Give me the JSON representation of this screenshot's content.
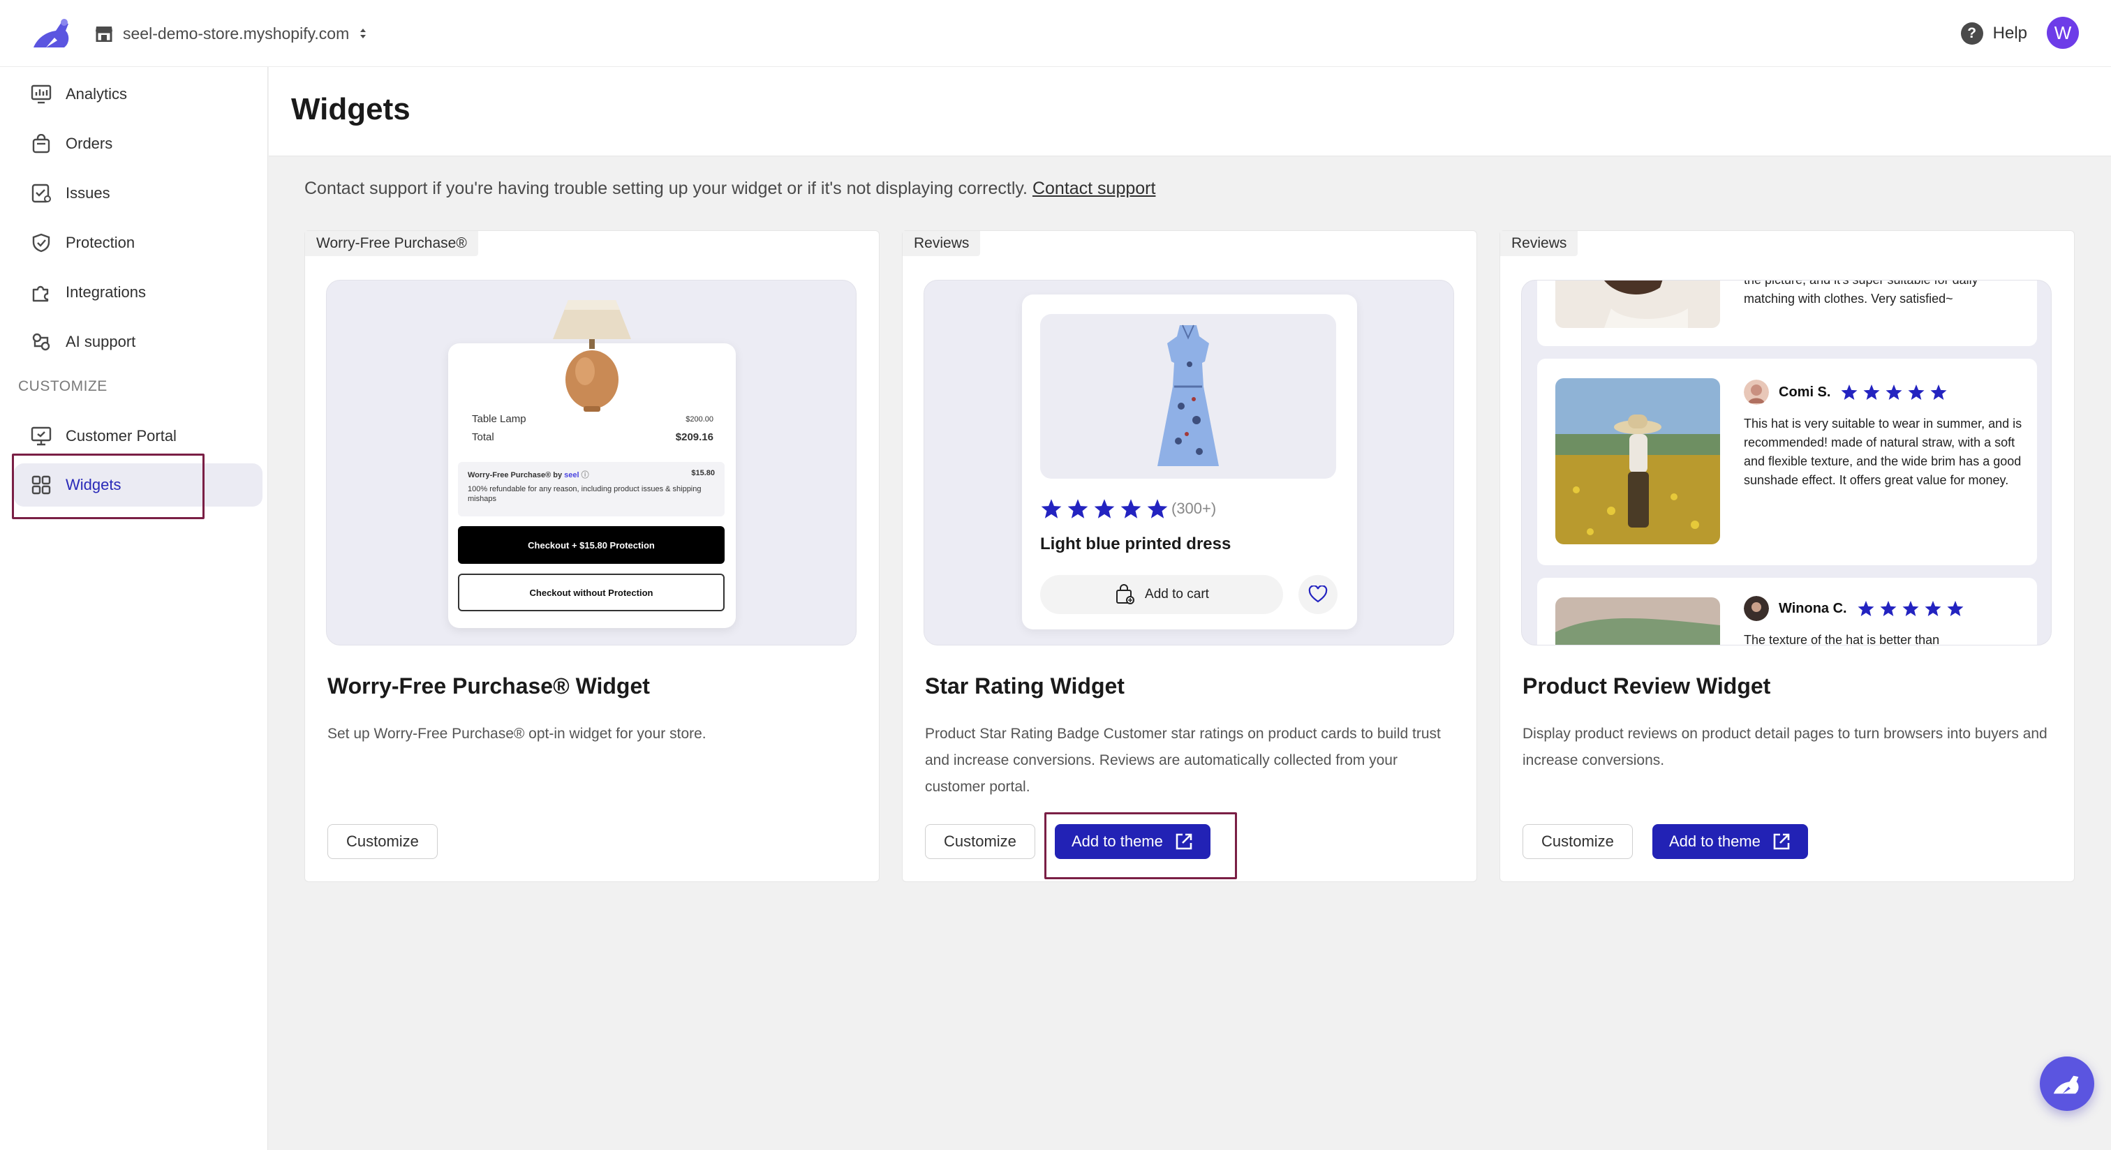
{
  "topbar": {
    "store_name": "seel-demo-store.myshopify.com",
    "help_label": "Help",
    "avatar_initial": "W"
  },
  "sidebar": {
    "items": [
      {
        "label": "Analytics",
        "icon": "chart-icon"
      },
      {
        "label": "Orders",
        "icon": "bag-icon"
      },
      {
        "label": "Issues",
        "icon": "issue-icon"
      },
      {
        "label": "Protection",
        "icon": "shield-icon"
      },
      {
        "label": "Integrations",
        "icon": "puzzle-icon"
      },
      {
        "label": "AI support",
        "icon": "ai-icon"
      }
    ],
    "section_label": "CUSTOMIZE",
    "customize_items": [
      {
        "label": "Customer Portal",
        "icon": "monitor-icon"
      },
      {
        "label": "Widgets",
        "icon": "grid-icon",
        "active": true
      }
    ]
  },
  "page": {
    "title": "Widgets",
    "support_text": "Contact support if you're having trouble setting up your widget or if it's not displaying correctly.",
    "support_link": "Contact support"
  },
  "cards": [
    {
      "tag": "Worry-Free Purchase®",
      "title": "Worry-Free Purchase® Widget",
      "description": "Set up Worry-Free Purchase® opt-in widget for your store.",
      "customize_label": "Customize",
      "preview": {
        "item_name": "Table Lamp",
        "item_price": "$200.00",
        "total_label": "Total",
        "total_value": "$209.16",
        "wfp_title": "Worry-Free Purchase® by",
        "wfp_brand": "seel",
        "wfp_price": "$15.80",
        "wfp_desc": "100% refundable for any reason, including product issues & shipping mishaps",
        "checkout_with": "Checkout + $15.80 Protection",
        "checkout_without": "Checkout without Protection"
      }
    },
    {
      "tag": "Reviews",
      "title": "Star Rating Widget",
      "description": "Product Star Rating Badge Customer star ratings on product cards to build trust and increase conversions. Reviews are automatically collected from your customer portal.",
      "customize_label": "Customize",
      "add_label": "Add to theme",
      "preview": {
        "rating_count": "(300+)",
        "rating": 5,
        "product_name": "Light blue printed dress",
        "cart_label": "Add to cart"
      }
    },
    {
      "tag": "Reviews",
      "title": "Product Review Widget",
      "description": "Display product reviews on product detail pages to turn browsers into buyers and increase conversions.",
      "customize_label": "Customize",
      "add_label": "Add to theme",
      "preview": {
        "review0_text": "the picture, and it's super suitable for daily matching with clothes. Very satisfied~",
        "review1_name": "Comi S.",
        "review1_rating": 5,
        "review1_text": "This hat is very suitable to wear in summer, and is recommended! made of natural straw, with a soft and flexible texture, and the wide brim has a good sunshade effect. It offers great value for money.",
        "review2_name": "Winona C.",
        "review2_rating": 5,
        "review2_text": "The texture of the hat is better than"
      }
    }
  ],
  "colors": {
    "accent": "#2222b5",
    "star": "#2323c0",
    "highlight": "#7a1f45"
  }
}
